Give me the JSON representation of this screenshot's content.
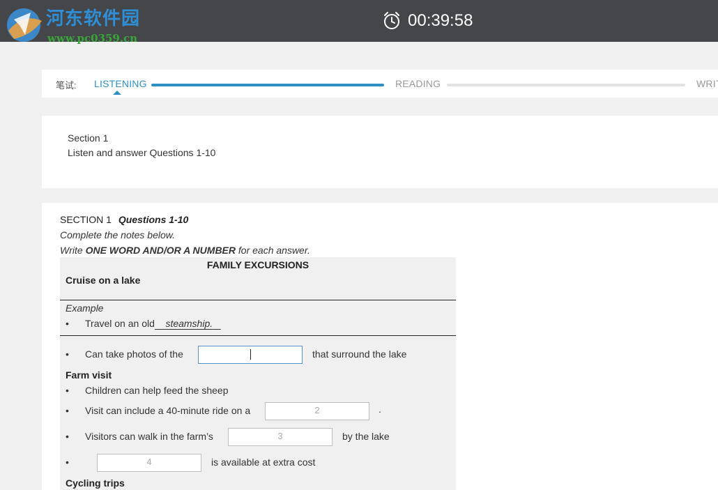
{
  "app": {
    "logo_text": "河东软件园",
    "logo_url": "www.pc0359.cn",
    "timer": "00:39:58"
  },
  "progress": {
    "label": "笔试:",
    "steps": [
      {
        "label": "LISTENING",
        "state": "active",
        "fill": 1.0
      },
      {
        "label": "READING",
        "state": "inactive",
        "fill": 0.0
      },
      {
        "label": "WRIT",
        "state": "inactive"
      }
    ],
    "colors": {
      "active": "#2e8fc4",
      "inactive": "#e3e3e3"
    }
  },
  "intro": {
    "section": "Section 1",
    "instruction": "Listen and answer Questions 1-10"
  },
  "content": {
    "section_label": "SECTION 1",
    "questions_label": "Questions 1-10",
    "instruction1": "Complete the notes below.",
    "instruction2_pre": "Write ",
    "instruction2_bold": "ONE WORD AND/OR A NUMBER",
    "instruction2_post": " for each answer.",
    "notes": {
      "title": "FAMILY EXCURSIONS",
      "cruise_heading": "Cruise on a lake",
      "example_label": "Example",
      "bullet": "•",
      "example_text": "Travel on an old",
      "example_answer": "steamship.",
      "q1_pre": "Can take photos of the",
      "q1_post": "that surround the lake",
      "farm_heading": "Farm visit",
      "farm_line1": "Children can help feed the sheep",
      "q2_pre": "Visit can include a 40-minute ride on a",
      "q2_placeholder": "2",
      "q2_post": ".",
      "q3_pre": "Visitors can walk in the farm’s",
      "q3_placeholder": "3",
      "q3_post": "by the lake",
      "q4_placeholder": "4",
      "q4_post": "is available at extra cost",
      "cycling_heading": "Cycling trips"
    }
  }
}
